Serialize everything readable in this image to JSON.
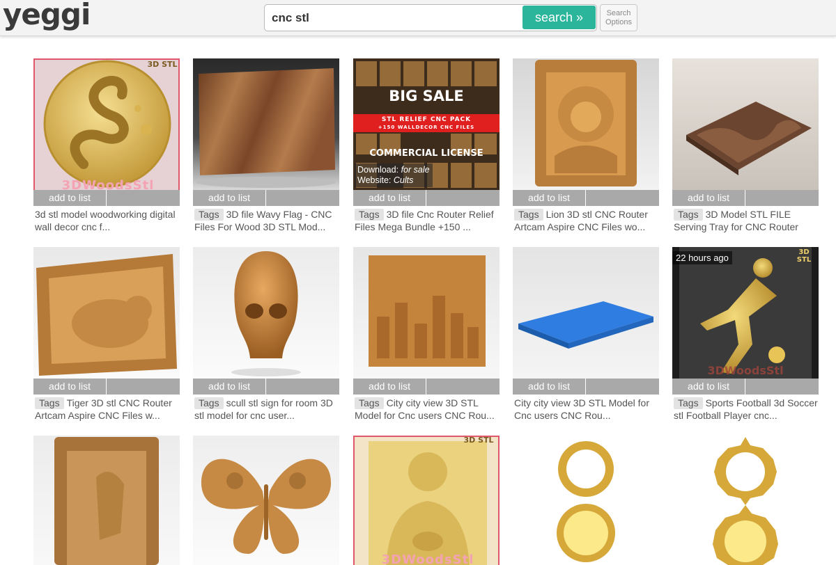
{
  "header": {
    "logo": "yeggi",
    "search_value": "cnc stl",
    "search_button": "search »",
    "options_line1": "Search",
    "options_line2": "Options"
  },
  "common": {
    "add_to_list": "add to list",
    "tags_label": "Tags"
  },
  "results": [
    {
      "title": "3d stl model woodworking digital wall decor cnc f...",
      "tags": false,
      "watermark": "3DWoodsStl",
      "badge": "3D STL"
    },
    {
      "title": "3D file Wavy Flag - CNC Files For Wood 3D STL Mod...",
      "tags": true
    },
    {
      "title": "3D file Cnc Router Relief Files Mega Bundle +150 ...",
      "tags": true,
      "promo_big": "BIG SALE",
      "promo_stl": "STL RELIEF CNC PACK",
      "promo_sub": "+150 WALLDECOR CNC FILES",
      "promo_lic": "COMMERCIAL LICENSE",
      "download_label": "Download:",
      "download_value": "for sale",
      "website_label": "Website:",
      "website_value": "Cults"
    },
    {
      "title": "Lion 3D stl CNC Router Artcam Aspire CNC Files wo...",
      "tags": true
    },
    {
      "title": "3D Model STL FILE Serving Tray for CNC Router",
      "tags": true
    },
    {
      "title": "Tiger 3D stl CNC Router Artcam Aspire CNC Files w...",
      "tags": true
    },
    {
      "title": "scull stl sign for room 3D stl model for cnc user...",
      "tags": true
    },
    {
      "title": "City city view 3D STL Model for Cnc users CNC Rou...",
      "tags": true
    },
    {
      "title": "City city view 3D STL Model for Cnc users CNC Rou...",
      "tags": false
    },
    {
      "title": "Sports Football 3d Soccer stl Football Player cnc...",
      "tags": true,
      "age": "22 hours ago",
      "badge": "3D STL",
      "watermark": "3DWoodsStl"
    },
    {
      "title": "",
      "tags": false
    },
    {
      "title": "",
      "tags": false
    },
    {
      "title": "",
      "tags": false,
      "watermark": "3DWoodsStl",
      "badge": "3D STL"
    },
    {
      "title": "",
      "tags": false
    },
    {
      "title": "",
      "tags": false
    }
  ],
  "colors": {
    "accent": "#2bb59b",
    "wood": "#c8893e",
    "gold": "#e8c456"
  }
}
